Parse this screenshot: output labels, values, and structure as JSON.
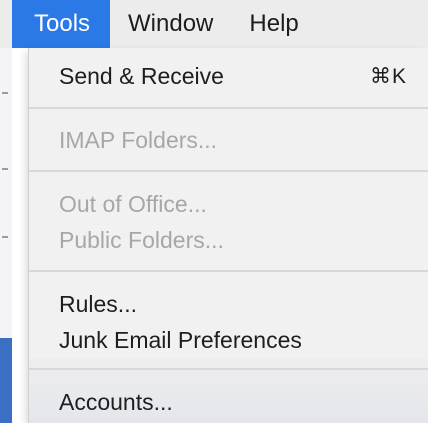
{
  "menubar": {
    "items": [
      {
        "label": "Tools"
      },
      {
        "label": "Window"
      },
      {
        "label": "Help"
      }
    ]
  },
  "tools_menu": {
    "send_receive": {
      "label": "Send & Receive",
      "shortcut": "⌘K"
    },
    "imap_folders": {
      "label": "IMAP Folders..."
    },
    "out_of_office": {
      "label": "Out of Office..."
    },
    "public_folders": {
      "label": "Public Folders..."
    },
    "rules": {
      "label": "Rules..."
    },
    "junk_email_preferences": {
      "label": "Junk Email Preferences"
    },
    "accounts": {
      "label": "Accounts..."
    }
  },
  "colors": {
    "active_menu_highlight": "#2a79e6",
    "menu_background": "#f1f1f1",
    "disabled_text": "#a7a7a7"
  }
}
